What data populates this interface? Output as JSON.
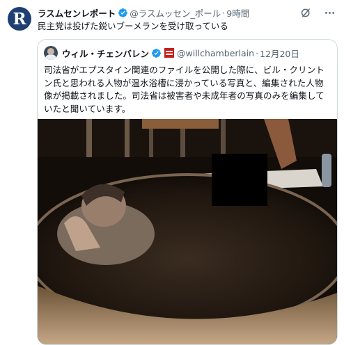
{
  "tweet": {
    "author_initial": "R",
    "author_name": "ラスムセンレポート",
    "handle": "@ラスムッセン_ポール",
    "separator": "·",
    "time": "9時間",
    "text": "民主党は投げた鋭いブーメランを受け取っている"
  },
  "quote": {
    "author_name": "ウィル・チェンバレン",
    "handle": "@willchamberlain",
    "separator": "·",
    "date": "12月20日",
    "text_lines": [
      "司法省がエプスタイン関連のファイルを公開した際に、ビル・クリント",
      "ン氏と思われる人物が温水浴槽に浸かっている写真と、編集された人物",
      "像が掲載されました。司法省は被害者や未成年者の写真のみを編集して",
      "いたと聞いています。"
    ]
  },
  "colors": {
    "verified": "#1d9bf0",
    "handle_gray": "#536471",
    "border": "#cfd9de",
    "avatar_bg": "#1d3f73",
    "flag_red": "#c41e1e"
  },
  "icons": {
    "grok": "grok-icon",
    "more": "more-icon",
    "verified": "verified-badge-icon",
    "flag": "flag-icon"
  }
}
